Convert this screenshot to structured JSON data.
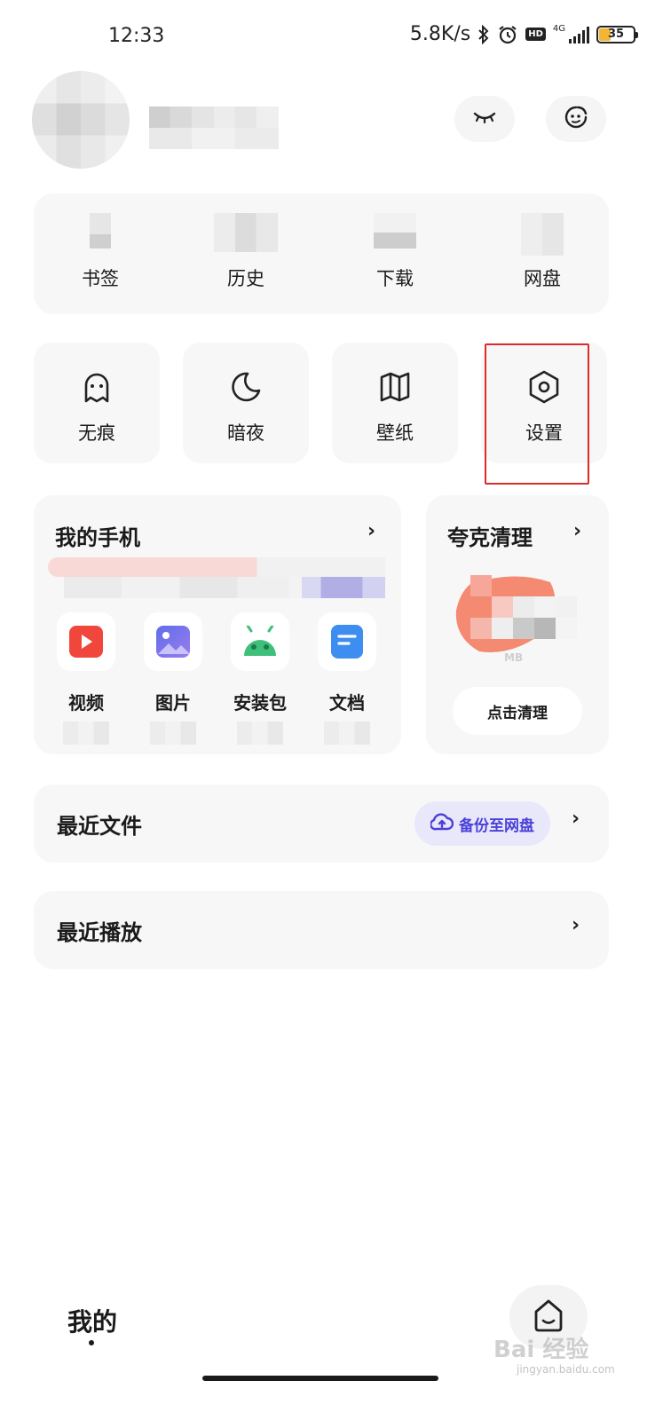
{
  "status_bar": {
    "time": "12:33",
    "net_speed": "5.8K/s",
    "network": "4G",
    "hd": "HD",
    "battery": "35",
    "battery_color": "#f2b534"
  },
  "header": {
    "avatar": "avatar (pixelated)",
    "username": "",
    "icons": [
      "eye-closed-icon",
      "face-icon"
    ]
  },
  "quick_links": [
    {
      "label": "书签"
    },
    {
      "label": "历史"
    },
    {
      "label": "下载"
    },
    {
      "label": "网盘"
    }
  ],
  "features": [
    {
      "label": "无痕",
      "icon": "ghost-icon"
    },
    {
      "label": "暗夜",
      "icon": "moon-icon"
    },
    {
      "label": "壁纸",
      "icon": "map-icon"
    },
    {
      "label": "设置",
      "icon": "settings-icon"
    }
  ],
  "my_phone": {
    "title": "我的手机",
    "file_types": [
      {
        "label": "视频",
        "icon": "video-icon",
        "color": "#f0463c"
      },
      {
        "label": "图片",
        "icon": "image-icon",
        "color": "#6b6be8"
      },
      {
        "label": "安装包",
        "icon": "android-icon",
        "color": "#3ec07a"
      },
      {
        "label": "文档",
        "icon": "document-icon",
        "color": "#3d8ef0"
      }
    ]
  },
  "cleaner": {
    "title": "夸克清理",
    "unit": "MB",
    "button": "点击清理"
  },
  "recent_files": {
    "title": "最近文件",
    "backup_label": "备份至网盘",
    "accent": "#4a41d8"
  },
  "recent_play": {
    "title": "最近播放"
  },
  "bottom_nav": {
    "mine_label": "我的",
    "home_icon": "home-icon"
  },
  "watermark": {
    "text": "Bai 经验",
    "sub": "jingyan.baidu.com"
  }
}
